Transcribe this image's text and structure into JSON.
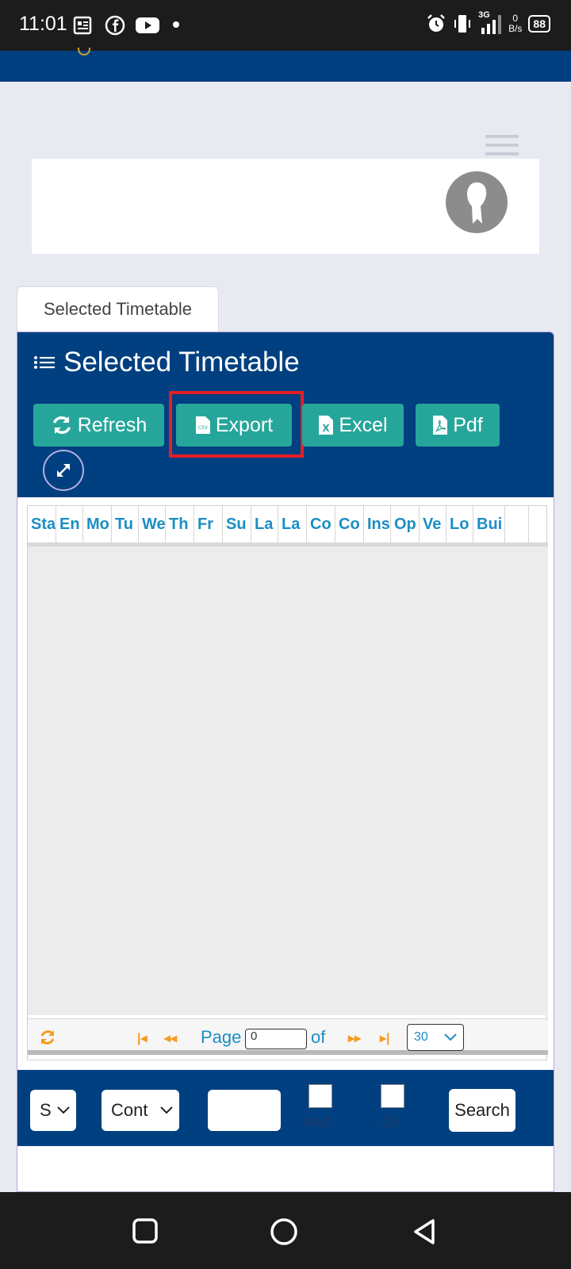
{
  "status_bar": {
    "time": "11:01",
    "net_speed_value": "0",
    "net_speed_unit": "B/s",
    "battery": "88",
    "network": "3G"
  },
  "tab": {
    "label": "Selected Timetable"
  },
  "panel": {
    "title": "Selected Timetable",
    "buttons": {
      "refresh": "Refresh",
      "export": "Export",
      "excel": "Excel",
      "pdf": "Pdf"
    },
    "button_color": "#26a69a",
    "header_color": "#003f80",
    "highlight_color": "#e41e26"
  },
  "grid": {
    "columns": [
      "Sta",
      "En",
      "Mo",
      "Tu",
      "We",
      "Th",
      "Fr",
      "Su",
      "La",
      "La",
      "Co",
      "Co",
      "Ins",
      "Op",
      "Ve",
      "Lo",
      "Bui"
    ],
    "pager": {
      "page_label": "Page",
      "page_value": "0",
      "of_label": "of",
      "rows_per_page": "30"
    }
  },
  "search": {
    "field_select": "S",
    "operator_select": "Cont",
    "and_label": "And",
    "or_label": "Or",
    "search_button": "Search"
  }
}
